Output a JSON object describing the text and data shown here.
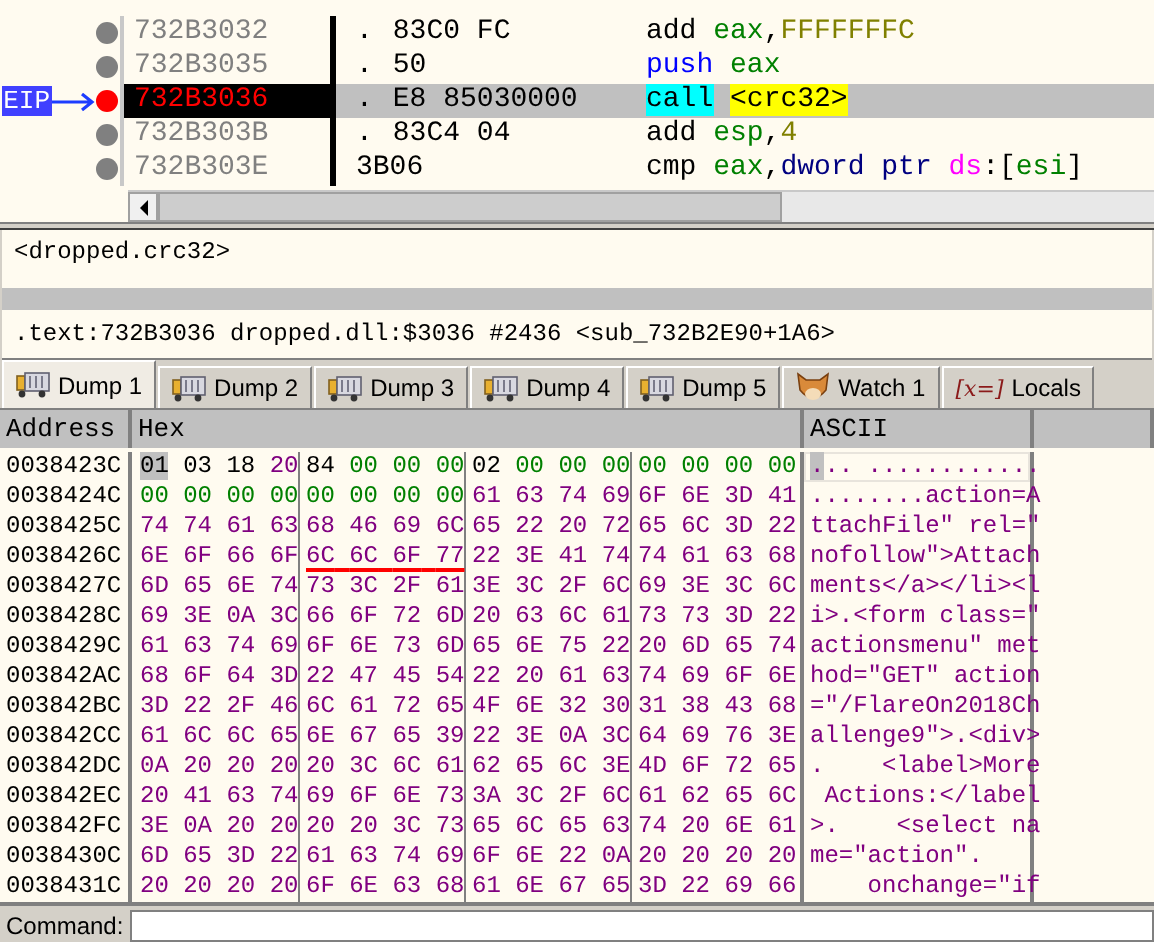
{
  "disassembly": {
    "eip_label": "EIP",
    "rows": [
      {
        "address": "732B3032",
        "mark": ".",
        "bytes": "83C0 FC",
        "current": false,
        "tokens": [
          {
            "text": "add",
            "kind": "mnemonic",
            "spaced": false
          },
          {
            "text": "eax",
            "kind": "register",
            "spaced": true
          },
          {
            "text": ",",
            "kind": "plain",
            "spaced": false
          },
          {
            "text": "FFFFFFFC",
            "kind": "number",
            "spaced": false
          }
        ]
      },
      {
        "address": "732B3035",
        "mark": ".",
        "bytes": "50",
        "current": false,
        "tokens": [
          {
            "text": "push",
            "kind": "stack",
            "spaced": false
          },
          {
            "text": "eax",
            "kind": "register",
            "spaced": true
          }
        ]
      },
      {
        "address": "732B3036",
        "mark": ".",
        "bytes": "E8 85030000",
        "current": true,
        "tokens": [
          {
            "text": "call",
            "kind": "call",
            "spaced": false
          },
          {
            "text": "<crc32>",
            "kind": "label",
            "spaced": true
          }
        ]
      },
      {
        "address": "732B303B",
        "mark": ".",
        "bytes": "83C4 04",
        "current": false,
        "tokens": [
          {
            "text": "add",
            "kind": "mnemonic",
            "spaced": false
          },
          {
            "text": "esp",
            "kind": "register",
            "spaced": true
          },
          {
            "text": ",",
            "kind": "plain",
            "spaced": false
          },
          {
            "text": "4",
            "kind": "number",
            "spaced": false
          }
        ]
      },
      {
        "address": "732B303E",
        "bytes": "3B06",
        "current": false,
        "tokens": [
          {
            "text": "cmp",
            "kind": "mnemonic",
            "spaced": false
          },
          {
            "text": "eax",
            "kind": "register",
            "spaced": true
          },
          {
            "text": ",",
            "kind": "plain",
            "spaced": false
          },
          {
            "text": "dword ptr",
            "kind": "size",
            "spaced": false
          },
          {
            "text": "ds",
            "kind": "segment",
            "spaced": true
          },
          {
            "text": ":[",
            "kind": "plain",
            "spaced": false
          },
          {
            "text": "esi",
            "kind": "register",
            "spaced": false
          },
          {
            "text": "]",
            "kind": "plain",
            "spaced": false
          }
        ]
      }
    ]
  },
  "info_panel": {
    "lines": [
      {
        "text": "<dropped.crc32>",
        "selected": false
      },
      {
        "selected": true
      },
      {
        "text": ".text:732B3036 dropped.dll:$3036 #2436 <sub_732B2E90+1A6>",
        "selected": false
      }
    ]
  },
  "tabs": [
    {
      "label": "Dump 1",
      "kind": "dump",
      "selected": true
    },
    {
      "label": "Dump 2",
      "kind": "dump",
      "selected": false
    },
    {
      "label": "Dump 3",
      "kind": "dump",
      "selected": false
    },
    {
      "label": "Dump 4",
      "kind": "dump",
      "selected": false
    },
    {
      "label": "Dump 5",
      "kind": "dump",
      "selected": false
    },
    {
      "label": "Watch 1",
      "kind": "watch",
      "selected": false
    },
    {
      "label": "Locals",
      "kind": "locals",
      "icon_text": "[x=]",
      "selected": false
    }
  ],
  "dump": {
    "columns": [
      "Address",
      "Hex",
      "ASCII"
    ],
    "rows": [
      {
        "address": "0038423C",
        "hex": [
          "01 03 18 20",
          "84 00 00 00",
          "02 00 00 00",
          "00 00 00 00"
        ],
        "underlined": [
          false,
          false,
          false,
          false
        ],
        "ascii": "... ............",
        "selected": true
      },
      {
        "address": "0038424C",
        "hex": [
          "00 00 00 00",
          "00 00 00 00",
          "61 63 74 69",
          "6F 6E 3D 41"
        ],
        "underlined": [
          false,
          false,
          false,
          false
        ],
        "ascii": "........action=A",
        "selected": false
      },
      {
        "address": "0038425C",
        "hex": [
          "74 74 61 63",
          "68 46 69 6C",
          "65 22 20 72",
          "65 6C 3D 22"
        ],
        "underlined": [
          false,
          false,
          false,
          false
        ],
        "ascii": "ttachFile\" rel=\"",
        "selected": false
      },
      {
        "address": "0038426C",
        "hex": [
          "6E 6F 66 6F",
          "6C 6C 6F 77",
          "22 3E 41 74",
          "74 61 63 68"
        ],
        "underlined": [
          false,
          true,
          false,
          false
        ],
        "ascii": "nofollow\">Attach",
        "selected": false
      },
      {
        "address": "0038427C",
        "hex": [
          "6D 65 6E 74",
          "73 3C 2F 61",
          "3E 3C 2F 6C",
          "69 3E 3C 6C"
        ],
        "underlined": [
          false,
          false,
          false,
          false
        ],
        "ascii": "ments</a></li><l",
        "selected": false
      },
      {
        "address": "0038428C",
        "hex": [
          "69 3E 0A 3C",
          "66 6F 72 6D",
          "20 63 6C 61",
          "73 73 3D 22"
        ],
        "underlined": [
          false,
          false,
          false,
          false
        ],
        "ascii": "i>.<form class=\"",
        "selected": false
      },
      {
        "address": "0038429C",
        "hex": [
          "61 63 74 69",
          "6F 6E 73 6D",
          "65 6E 75 22",
          "20 6D 65 74"
        ],
        "underlined": [
          false,
          false,
          false,
          false
        ],
        "ascii": "actionsmenu\" met",
        "selected": false
      },
      {
        "address": "003842AC",
        "hex": [
          "68 6F 64 3D",
          "22 47 45 54",
          "22 20 61 63",
          "74 69 6F 6E"
        ],
        "underlined": [
          false,
          false,
          false,
          false
        ],
        "ascii": "hod=\"GET\" action",
        "selected": false
      },
      {
        "address": "003842BC",
        "hex": [
          "3D 22 2F 46",
          "6C 61 72 65",
          "4F 6E 32 30",
          "31 38 43 68"
        ],
        "underlined": [
          false,
          false,
          false,
          false
        ],
        "ascii": "=\"/FlareOn2018Ch",
        "selected": false
      },
      {
        "address": "003842CC",
        "hex": [
          "61 6C 6C 65",
          "6E 67 65 39",
          "22 3E 0A 3C",
          "64 69 76 3E"
        ],
        "underlined": [
          false,
          false,
          false,
          false
        ],
        "ascii": "allenge9\">.<div>",
        "selected": false
      },
      {
        "address": "003842DC",
        "hex": [
          "0A 20 20 20",
          "20 3C 6C 61",
          "62 65 6C 3E",
          "4D 6F 72 65"
        ],
        "underlined": [
          false,
          false,
          false,
          false
        ],
        "ascii": ".    <label>More",
        "selected": false
      },
      {
        "address": "003842EC",
        "hex": [
          "20 41 63 74",
          "69 6F 6E 73",
          "3A 3C 2F 6C",
          "61 62 65 6C"
        ],
        "underlined": [
          false,
          false,
          false,
          false
        ],
        "ascii": " Actions:</label",
        "selected": false
      },
      {
        "address": "003842FC",
        "hex": [
          "3E 0A 20 20",
          "20 20 3C 73",
          "65 6C 65 63",
          "74 20 6E 61"
        ],
        "underlined": [
          false,
          false,
          false,
          false
        ],
        "ascii": ">.    <select na",
        "selected": false
      },
      {
        "address": "0038430C",
        "hex": [
          "6D 65 3D 22",
          "61 63 74 69",
          "6F 6E 22 0A",
          "20 20 20 20"
        ],
        "underlined": [
          false,
          false,
          false,
          false
        ],
        "ascii": "me=\"action\".",
        "selected": false
      },
      {
        "address": "0038431C",
        "hex": [
          "20 20 20 20",
          "6F 6E 63 68",
          "61 6E 67 65",
          "3D 22 69 66"
        ],
        "underlined": [
          false,
          false,
          false,
          false
        ],
        "ascii": "    onchange=\"if",
        "selected": false
      }
    ]
  },
  "command_bar": {
    "label": "Command:"
  }
}
